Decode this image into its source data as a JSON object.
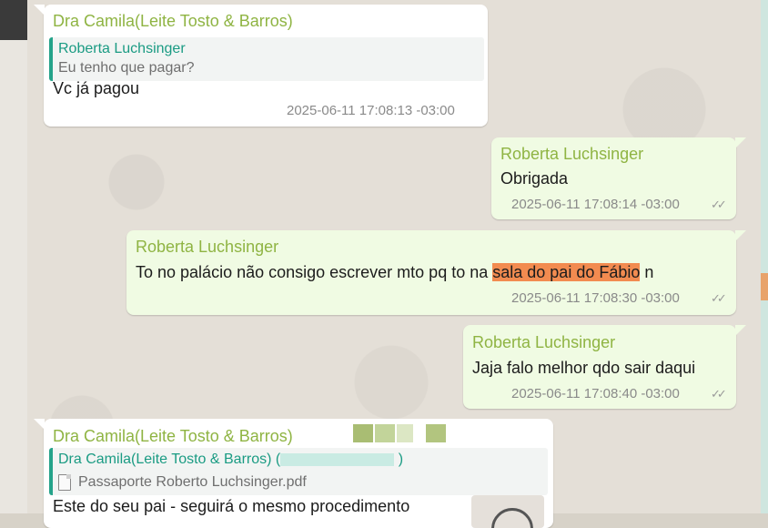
{
  "messages": [
    {
      "direction": "in",
      "sender": "Dra Camila(Leite Tosto & Barros)",
      "quote": {
        "sender": "Roberta Luchsinger",
        "text": "Eu tenho que pagar?"
      },
      "text": "Vc já pagou",
      "time": "2025-06-11 17:08:13 -03:00"
    },
    {
      "direction": "out",
      "sender": "Roberta Luchsinger",
      "text": "Obrigada",
      "time": "2025-06-11 17:08:14 -03:00",
      "ticks": "✓✓"
    },
    {
      "direction": "out",
      "sender": "Roberta Luchsinger",
      "text_before": "To no palácio não consigo escrever mto pq to na ",
      "text_highlight": "sala do pai do Fábio",
      "text_after": " n",
      "time": "2025-06-11 17:08:30 -03:00",
      "ticks": "✓✓",
      "highlight_color": "#f28b50"
    },
    {
      "direction": "out",
      "sender": "Roberta Luchsinger",
      "text": "Jaja falo melhor qdo sair daqui",
      "time": "2025-06-11 17:08:40 -03:00",
      "ticks": "✓✓"
    },
    {
      "direction": "in",
      "sender": "Dra Camila(Leite Tosto & Barros)",
      "quote": {
        "sender": "Dra Camila(Leite Tosto & Barros) (",
        "sender_end": ")",
        "file": "Passaporte Roberto Luchsinger.pdf"
      },
      "text": "Este do seu pai - seguirá o mesmo procedimento"
    }
  ],
  "colors": {
    "sender_name": "#8fb443",
    "quote_accent": "#25a38a",
    "incoming_bg": "#ffffff",
    "outgoing_bg": "#f0fbe3"
  },
  "icons": {
    "tick": "double-check-icon",
    "file": "pdf-file-icon"
  }
}
